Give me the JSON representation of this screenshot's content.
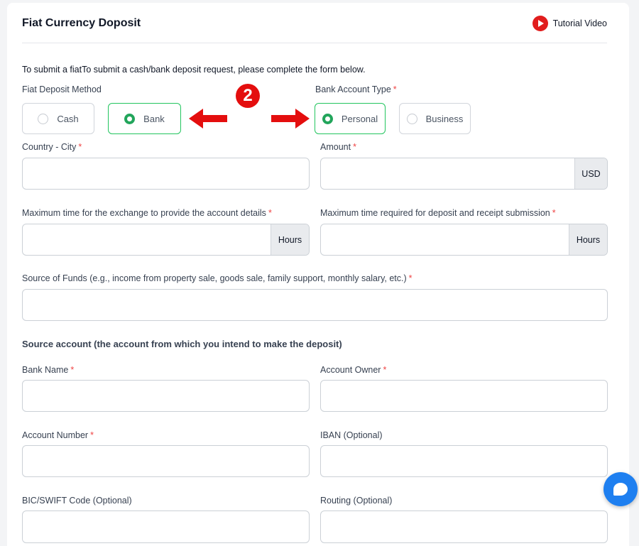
{
  "header": {
    "title": "Fiat Currency Doposit",
    "tutorial_label": "Tutorial Video"
  },
  "intro": "To submit a fiatTo submit a cash/bank deposit request, please complete the form below.",
  "deposit_method": {
    "label": "Fiat Deposit Method",
    "options": [
      "Cash",
      "Bank"
    ],
    "selected": "Bank"
  },
  "account_type": {
    "label": "Bank Account Type",
    "options": [
      "Personal",
      "Business"
    ],
    "selected": "Personal"
  },
  "annotation": {
    "step_number": "2"
  },
  "required_mark": "*",
  "fields": {
    "country_city": {
      "label": "Country - City"
    },
    "amount": {
      "label": "Amount",
      "suffix": "USD"
    },
    "exchange_time": {
      "label": "Maximum time for the exchange to provide the account details",
      "suffix": "Hours"
    },
    "deposit_time": {
      "label": "Maximum time required for deposit and receipt submission",
      "suffix": "Hours"
    },
    "source_of_funds": {
      "label": "Source of Funds (e.g., income from property sale, goods sale, family support, monthly salary, etc.)"
    }
  },
  "source_account": {
    "title": "Source account (the account from which you intend to make the deposit)",
    "bank_name": {
      "label": "Bank Name"
    },
    "account_owner": {
      "label": "Account Owner"
    },
    "account_number": {
      "label": "Account Number"
    },
    "iban": {
      "label": "IBAN (Optional)"
    },
    "bic_swift": {
      "label": "BIC/SWIFT Code (Optional)"
    },
    "routing": {
      "label": "Routing (Optional)"
    }
  },
  "colors": {
    "accent_green": "#22a55b",
    "annotation_red": "#e40e0e",
    "chat_blue": "#1e7ff0",
    "required_red": "#ef4444"
  },
  "icons": {
    "tutorial": "play-circle-icon",
    "chat": "chat-bubble-icon",
    "arrow_left": "arrow-left-icon",
    "arrow_right": "arrow-right-icon"
  }
}
